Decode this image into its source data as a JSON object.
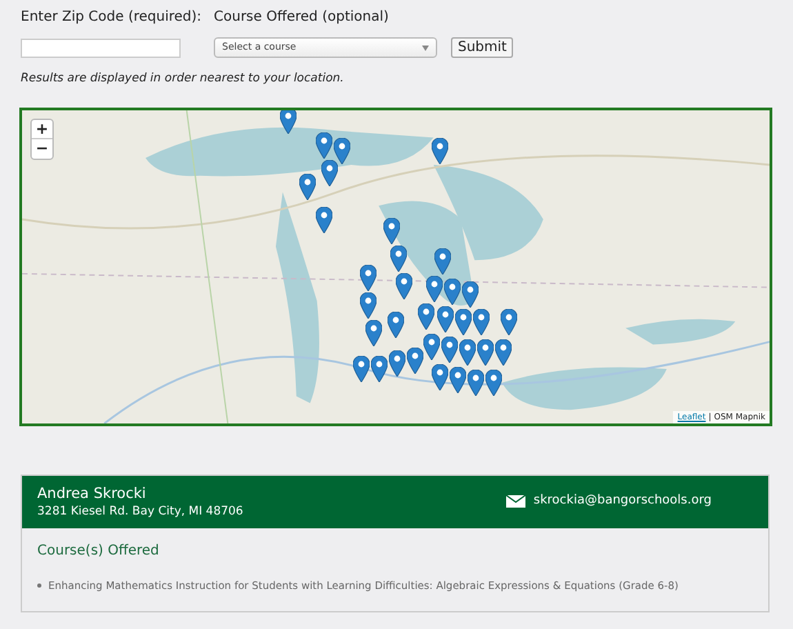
{
  "search_form": {
    "zip_label": "Enter Zip Code (required):",
    "course_label": "Course Offered (optional)",
    "course_select": {
      "value": "Select a course"
    },
    "submit": "Submit"
  },
  "results_note": "Results are displayed in order nearest to your location.",
  "map": {
    "kind": "picture",
    "zoom_in": "+",
    "zoom_out": "−",
    "attribution_link": "Leaflet",
    "attribution_separator": "|",
    "attribution_text": "OSM Mapnik"
  },
  "result": {
    "name": "Andrea Skrocki",
    "address": "3281 Kiesel Rd. Bay City, MI 48706",
    "email": "skrockia@bangorschools.org",
    "courses_heading": "Course(s) Offered",
    "courses": [
      "Enhancing Mathematics Instruction for Students with Learning Difficulties: Algebraic Expressions & Equations (Grade 6-8)"
    ]
  }
}
